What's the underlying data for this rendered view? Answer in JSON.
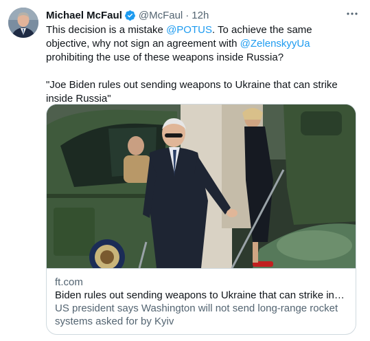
{
  "tweet": {
    "author_name": "Michael McFaul",
    "handle": "@McFaul",
    "separator": "·",
    "time": "12h",
    "text_part1": "This decision is a mistake ",
    "mention1": "@POTUS",
    "text_part2": ". To achieve the same objective, why not sign an agreement with ",
    "mention2": "@ZelenskyyUa",
    "text_part3": " prohibiting the use of these weapons inside Russia?",
    "quote": "\"Joe Biden rules out sending weapons to Ukraine that can strike inside Russia\""
  },
  "card": {
    "domain": "ft.com",
    "title": "Biden rules out sending weapons to Ukraine that can strike inside Rus...",
    "description": "US president says Washington will not send long-range rocket systems asked for by Kyiv"
  },
  "icons": {
    "verified": "verified-badge-icon",
    "more": "more-options-icon"
  },
  "colors": {
    "link": "#1d9bf0",
    "secondary_text": "#536471",
    "verified": "#1d9bf0",
    "helicopter": "#3f5a3c"
  }
}
